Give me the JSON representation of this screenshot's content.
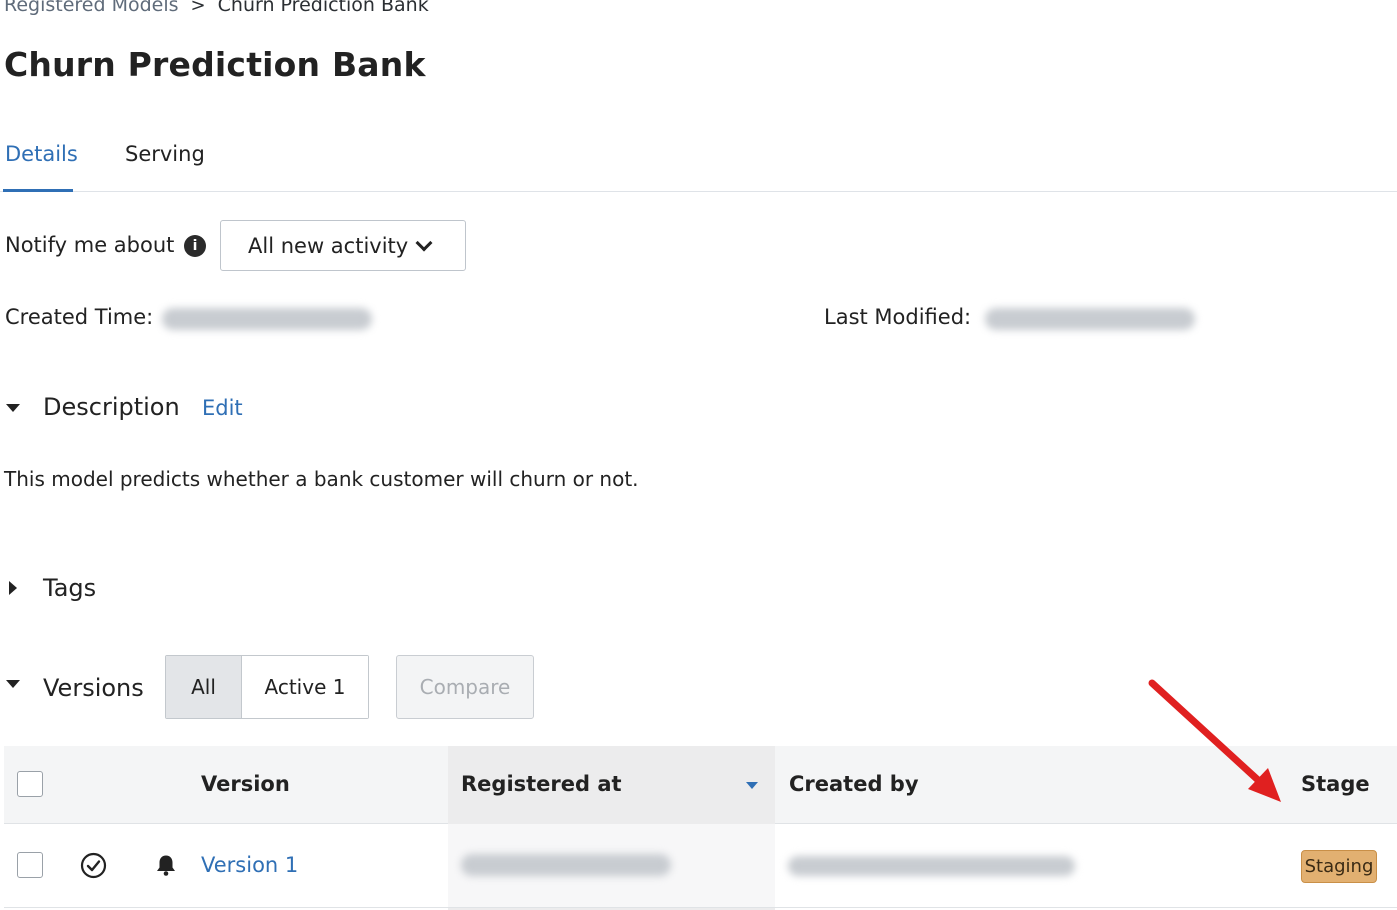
{
  "breadcrumb": {
    "parent": "Registered Models",
    "separator": ">",
    "current": "Churn Prediction Bank"
  },
  "page_title": "Churn Prediction Bank",
  "tabs": [
    {
      "label": "Details",
      "active": true
    },
    {
      "label": "Serving",
      "active": false
    }
  ],
  "notify": {
    "label": "Notify me about",
    "info_icon": "i",
    "selected": "All new activity"
  },
  "meta": {
    "created_label": "Created Time:",
    "modified_label": "Last Modified:"
  },
  "description": {
    "title": "Description",
    "edit_label": "Edit",
    "text": "This model predicts whether a bank customer will churn or not."
  },
  "tags": {
    "title": "Tags"
  },
  "versions": {
    "title": "Versions",
    "filter_all": "All",
    "filter_active": "Active 1",
    "compare_label": "Compare",
    "columns": {
      "version": "Version",
      "registered_at": "Registered at",
      "created_by": "Created by",
      "stage": "Stage"
    },
    "rows": [
      {
        "version": "Version 1",
        "stage": "Staging"
      }
    ]
  },
  "colors": {
    "accent": "#2f6fb5",
    "stage_badge": "#e2b071",
    "annotation_arrow": "#e02020"
  }
}
